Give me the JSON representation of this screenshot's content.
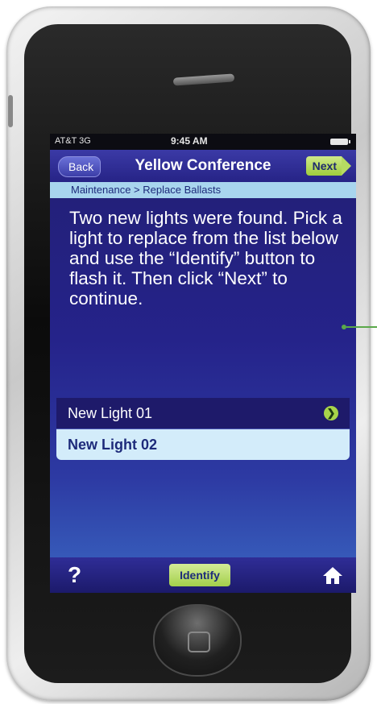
{
  "status_bar": {
    "carrier": "AT&T 3G",
    "time": "9:45 AM"
  },
  "nav": {
    "back_label": "Back",
    "title": "Yellow Conference",
    "next_label": "Next"
  },
  "breadcrumb": "Maintenance > Replace Ballasts",
  "instructions": "Two new lights were found. Pick a light to replace from the list below and use the “Identify” button to flash it. Then click “Next” to continue.",
  "lights": [
    {
      "label": "New Light 01"
    },
    {
      "label": "New Light 02"
    }
  ],
  "toolbar": {
    "help_label": "?",
    "identify_label": "Identify",
    "home_icon": "home-icon"
  },
  "colors": {
    "accent_green": "#a3d04a",
    "screen_blue": "#25238a",
    "breadcrumb_bg": "#a8d5ee"
  }
}
